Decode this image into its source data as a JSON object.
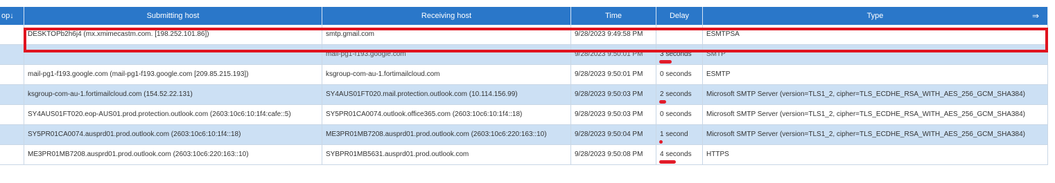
{
  "table": {
    "headers": {
      "op": "op↓",
      "submitting_host": "Submitting host",
      "receiving_host": "Receiving host",
      "time": "Time",
      "delay": "Delay",
      "type": "Type",
      "type_arrow": "⇒"
    },
    "rows": [
      {
        "submitting": "DESKTOPb2h6j4 (mx.xmimecastm.com. [198.252.101.86])",
        "receiving": "smtp.gmail.com",
        "time": "9/28/2023 9:49:58 PM",
        "delay": "",
        "type": "ESMTPSA"
      },
      {
        "submitting": "",
        "receiving": "mail-pg1-f193.google.com",
        "time": "9/28/2023 9:50:01 PM",
        "delay": "3 seconds",
        "type": "SMTP"
      },
      {
        "submitting": "mail-pg1-f193.google.com (mail-pg1-f193.google.com [209.85.215.193])",
        "receiving": "ksgroup-com-au-1.fortimailcloud.com",
        "time": "9/28/2023 9:50:01 PM",
        "delay": "0 seconds",
        "type": "ESMTP"
      },
      {
        "submitting": "ksgroup-com-au-1.fortimailcloud.com (154.52.22.131)",
        "receiving": "SY4AUS01FT020.mail.protection.outlook.com (10.114.156.99)",
        "time": "9/28/2023 9:50:03 PM",
        "delay": "2 seconds",
        "type": "Microsoft SMTP Server (version=TLS1_2, cipher=TLS_ECDHE_RSA_WITH_AES_256_GCM_SHA384)"
      },
      {
        "submitting": "SY4AUS01FT020.eop-AUS01.prod.protection.outlook.com (2603:10c6:10:1f4:cafe::5)",
        "receiving": "SY5PR01CA0074.outlook.office365.com (2603:10c6:10:1f4::18)",
        "time": "9/28/2023 9:50:03 PM",
        "delay": "0 seconds",
        "type": "Microsoft SMTP Server (version=TLS1_2, cipher=TLS_ECDHE_RSA_WITH_AES_256_GCM_SHA384)"
      },
      {
        "submitting": "SY5PR01CA0074.ausprd01.prod.outlook.com (2603:10c6:10:1f4::18)",
        "receiving": "ME3PR01MB7208.ausprd01.prod.outlook.com (2603:10c6:220:163::10)",
        "time": "9/28/2023 9:50:04 PM",
        "delay": "1 second",
        "type": "Microsoft SMTP Server (version=TLS1_2, cipher=TLS_ECDHE_RSA_WITH_AES_256_GCM_SHA384)"
      },
      {
        "submitting": "ME3PR01MB7208.ausprd01.prod.outlook.com (2603:10c6:220:163::10)",
        "receiving": "SYBPR01MB5631.ausprd01.prod.outlook.com",
        "time": "9/28/2023 9:50:08 PM",
        "delay": "4 seconds",
        "type": "HTTPS"
      }
    ]
  },
  "colors": {
    "header_bg": "#2a77c9",
    "row_alt_bg": "#cce0f4",
    "highlight": "#e0141f"
  }
}
